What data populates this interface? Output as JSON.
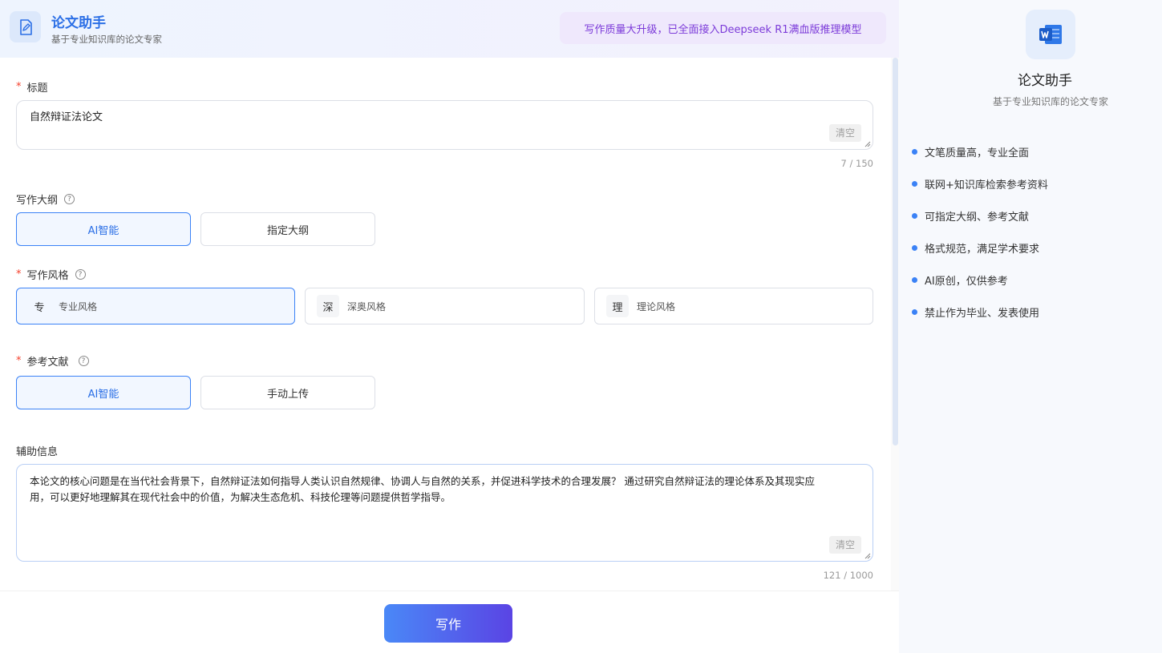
{
  "header": {
    "title": "论文助手",
    "subtitle": "基于专业知识库的论文专家",
    "promo": "写作质量大升级，已全面接入Deepseek R1满血版推理模型"
  },
  "form": {
    "title_label": "标题",
    "title_value": "自然辩证法论文",
    "title_clear": "清空",
    "title_counter": "7 / 150",
    "outline_label": "写作大纲",
    "outline_options": [
      "AI智能",
      "指定大纲"
    ],
    "outline_selected": "AI智能",
    "style_label": "写作风格",
    "styles": [
      {
        "badge": "专",
        "name": "专业风格"
      },
      {
        "badge": "深",
        "name": "深奥风格"
      },
      {
        "badge": "理",
        "name": "理论风格"
      }
    ],
    "style_selected": "专业风格",
    "refs_label": "参考文献",
    "refs_options": [
      "AI智能",
      "手动上传"
    ],
    "refs_selected": "AI智能",
    "aux_label": "辅助信息",
    "aux_value": "本论文的核心问题是在当代社会背景下，自然辩证法如何指导人类认识自然规律、协调人与自然的关系，并促进科学技术的合理发展？ 通过研究自然辩证法的理论体系及其现实应用，可以更好地理解其在现代社会中的价值，为解决生态危机、科技伦理等问题提供哲学指导。",
    "aux_clear": "清空",
    "aux_counter": "121 / 1000",
    "submit": "写作"
  },
  "sidebar": {
    "title": "论文助手",
    "subtitle": "基于专业知识库的论文专家",
    "features": [
      "文笔质量高，专业全面",
      "联网+知识库检索参考资料",
      "可指定大纲、参考文献",
      "格式规范，满足学术要求",
      "AI原创，仅供参考",
      "禁止作为毕业、发表使用"
    ]
  },
  "colors": {
    "accent": "#2b6fe6",
    "promo_text": "#7c3bd9",
    "required": "#f5402c"
  },
  "icons": {
    "header_logo": "document-edit-icon",
    "sidebar_logo": "word-doc-icon",
    "help": "question-circle-icon"
  }
}
